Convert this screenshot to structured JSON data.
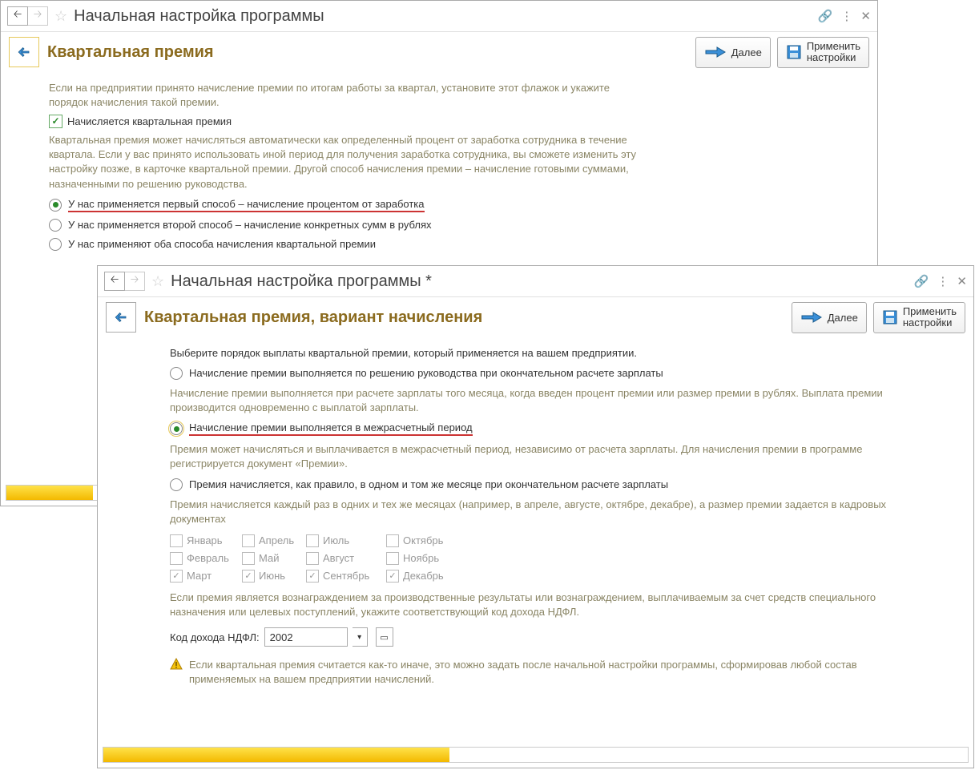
{
  "window1": {
    "title": "Начальная настройка программы",
    "sectionTitle": "Квартальная премия",
    "next": "Далее",
    "apply1": "Применить",
    "apply2": "настройки",
    "intro": "Если на предприятии принято начисление премии по итогам работы за квартал, установите этот флажок и укажите порядок начисления такой премии.",
    "checkboxLabel": "Начисляется квартальная премия",
    "desc": "Квартальная премия может начисляться автоматически как определенный процент от заработка сотрудника в течение квартала. Если у вас принято использовать иной период для получения заработка сотрудника, вы сможете изменить эту настройку позже, в карточке квартальной премии. Другой способ начисления премии – начисление готовыми суммами, назначенными по решению руководства.",
    "radio1": "У нас применяется первый способ – начисление процентом от заработка",
    "radio2": "У нас применяется второй способ – начисление конкретных сумм в рублях",
    "radio3": "У нас применяют оба способа начисления квартальной премии"
  },
  "window2": {
    "title": "Начальная настройка программы *",
    "sectionTitle": "Квартальная премия,  вариант начисления",
    "next": "Далее",
    "apply1": "Применить",
    "apply2": "настройки",
    "intro": "Выберите порядок выплаты квартальной премии, который применяется на вашем предприятии.",
    "r1": "Начисление премии выполняется по решению руководства при окончательном расчете зарплаты",
    "d1": "Начисление премии выполняется при расчете зарплаты того месяца, когда введен процент премии или размер премии в рублях. Выплата премии производится одновременно с выплатой зарплаты.",
    "r2": "Начисление премии выполняется в межрасчетный период",
    "d2": "Премия может начисляться и выплачивается в межрасчетный период, независимо от расчета зарплаты. Для начисления премии в программе регистрируется документ «Премии».",
    "r3": "Премия начисляется, как правило, в одном и том же месяце при окончательном расчете зарплаты",
    "d3": "Премия начисляется каждый раз в одних и тех же месяцах (например, в апреле, августе, октябре, декабре), а размер премии задается в кадровых документах",
    "months": {
      "jan": "Январь",
      "feb": "Февраль",
      "mar": "Март",
      "apr": "Апрель",
      "may": "Май",
      "jun": "Июнь",
      "jul": "Июль",
      "aug": "Август",
      "sep": "Сентябрь",
      "oct": "Октябрь",
      "nov": "Ноябрь",
      "dec": "Декабрь"
    },
    "ndflDesc": "Если премия является вознаграждением за производственные результаты или вознаграждением, выплачиваемым за счет средств специального назначения или целевых поступлений, укажите соответствующий код дохода НДФЛ.",
    "ndflLabel": "Код дохода НДФЛ:",
    "ndflValue": "2002",
    "warn": "Если квартальная премия считается как-то иначе, это можно задать после начальной настройки программы, сформировав любой состав применяемых на вашем предприятии начислений."
  }
}
